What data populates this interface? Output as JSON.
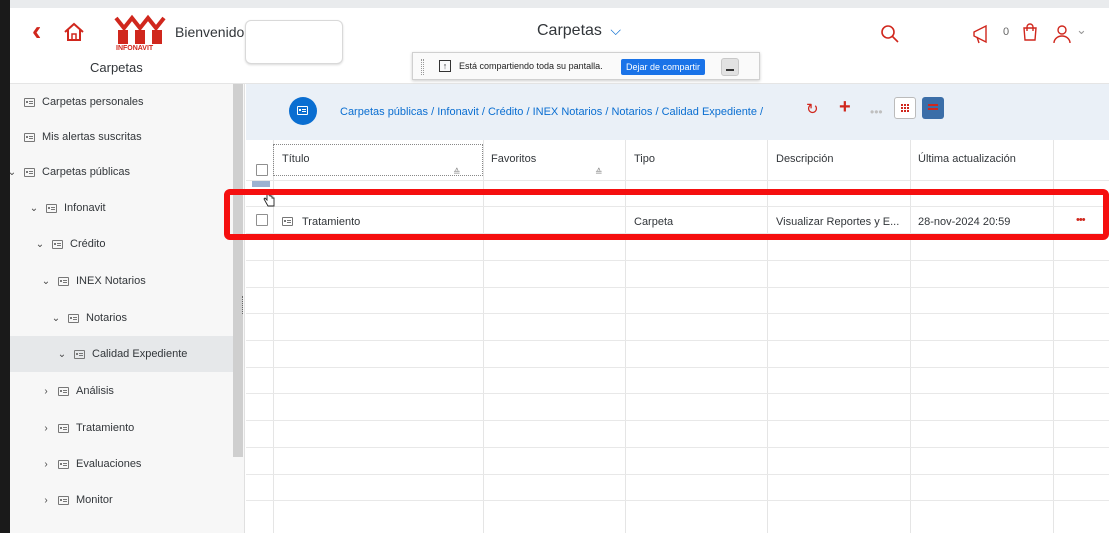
{
  "header": {
    "welcome_label": "Bienvenido:",
    "app_title": "Carpetas",
    "app_title_chevron": "⌵",
    "sidebar_title": "Carpetas",
    "logo_text": "INFONAVIT",
    "notification_count": "0",
    "icons": [
      "back-icon",
      "home-icon",
      "search-icon",
      "megaphone-icon",
      "shopping-icon",
      "user-icon"
    ]
  },
  "share_bar": {
    "message": "Está compartiendo toda su pantalla.",
    "stop_label": "Dejar de compartir"
  },
  "sidebar": {
    "items": [
      {
        "label": "Carpetas personales",
        "chevron": ""
      },
      {
        "label": "Mis alertas suscritas",
        "chevron": ""
      },
      {
        "label": "Carpetas públicas",
        "chevron": "⌄"
      },
      {
        "label": "Infonavit",
        "chevron": "⌄"
      },
      {
        "label": "Crédito",
        "chevron": "⌄"
      },
      {
        "label": "INEX Notarios",
        "chevron": "⌄"
      },
      {
        "label": "Notarios",
        "chevron": "⌄"
      },
      {
        "label": "Calidad Expediente",
        "chevron": "⌄"
      },
      {
        "label": "Análisis",
        "chevron": "›"
      },
      {
        "label": "Tratamiento",
        "chevron": "›"
      },
      {
        "label": "Evaluaciones",
        "chevron": "›"
      },
      {
        "label": "Monitor",
        "chevron": "›"
      }
    ]
  },
  "breadcrumb": {
    "path": "Carpetas públicas / Infonavit / Crédito / INEX Notarios / Notarios / Calidad Expediente /"
  },
  "toolbar": {
    "refresh": "↻",
    "add": "+",
    "more": "•••"
  },
  "table": {
    "headers": [
      "Título",
      "Favoritos",
      "Tipo",
      "Descripción",
      "Última actualización"
    ],
    "sort_glyph": "≙",
    "rows": [
      {
        "titulo": "Tratamiento",
        "favoritos": "",
        "tipo": "Carpeta",
        "descripcion": "Visualizar Reportes y E...",
        "actualizacion": "28-nov-2024 20:59",
        "more": "•••"
      }
    ]
  },
  "colors": {
    "accent": "#0a6ed1",
    "brand_red": "#d0271d",
    "highlight": "#f50f0f"
  }
}
